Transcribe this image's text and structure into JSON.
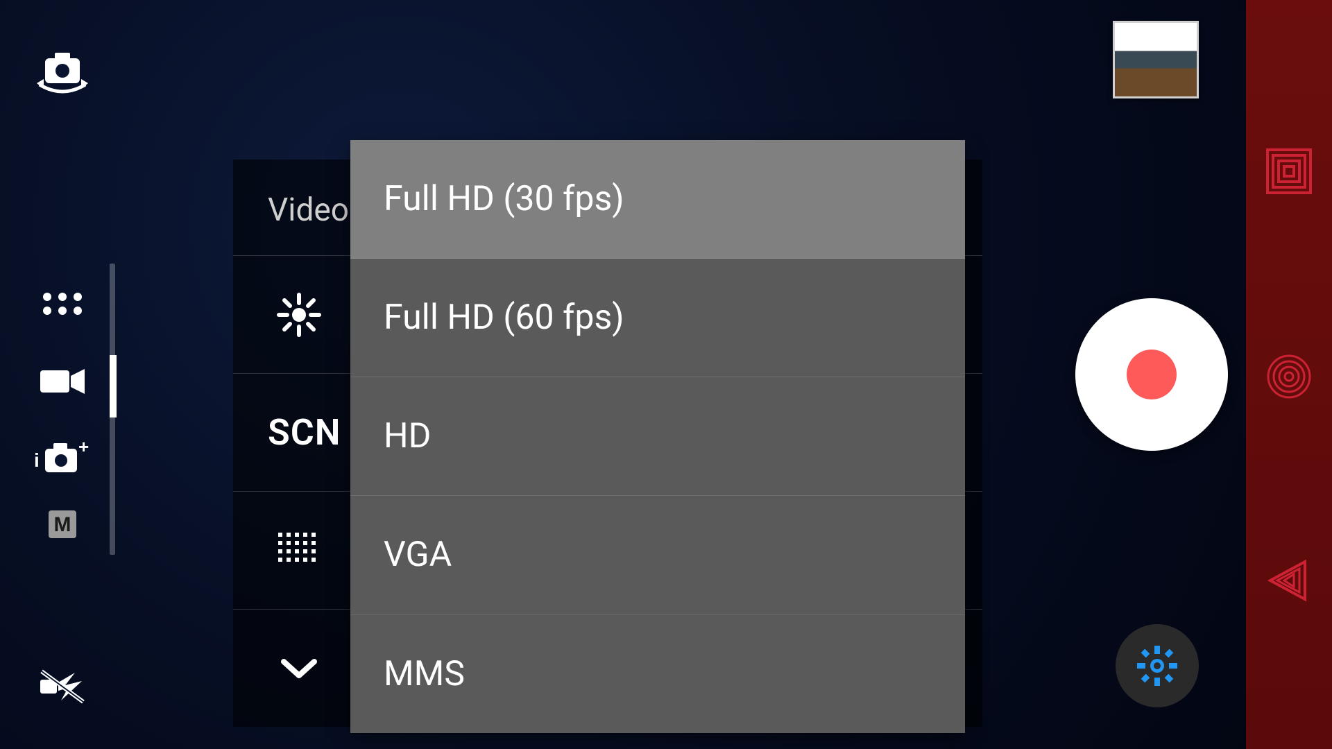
{
  "settings": {
    "header_label": "Video",
    "rows": {
      "scene_label": "SCN"
    }
  },
  "resolution_options": [
    {
      "label": "Full HD (30 fps)",
      "selected": true
    },
    {
      "label": "Full HD (60 fps)",
      "selected": false
    },
    {
      "label": "HD",
      "selected": false
    },
    {
      "label": "VGA",
      "selected": false
    },
    {
      "label": "MMS",
      "selected": false
    }
  ],
  "left_rail": {
    "modes": [
      "apps",
      "video",
      "superior-auto",
      "manual"
    ]
  }
}
